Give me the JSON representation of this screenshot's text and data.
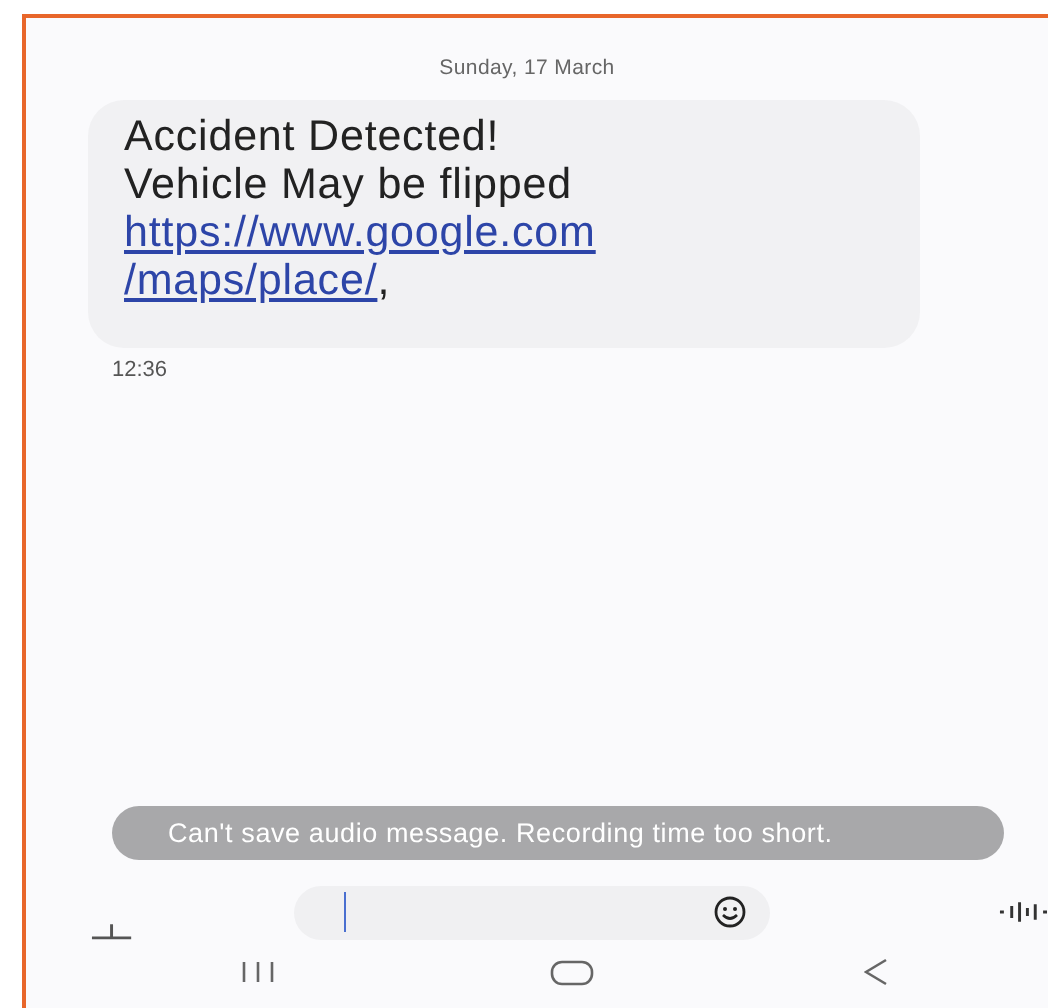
{
  "date_header": "Sunday, 17 March",
  "message": {
    "lines": [
      {
        "kind": "text",
        "text": "Accident Detected!"
      },
      {
        "kind": "text",
        "text": "Vehicle May be flipped"
      },
      {
        "kind": "link",
        "text": "https://www.google.com"
      },
      {
        "kind": "link",
        "text": "/maps/place/",
        "suffix": ","
      }
    ],
    "time": "12:36"
  },
  "toast": "Can't save audio message. Recording time too short."
}
